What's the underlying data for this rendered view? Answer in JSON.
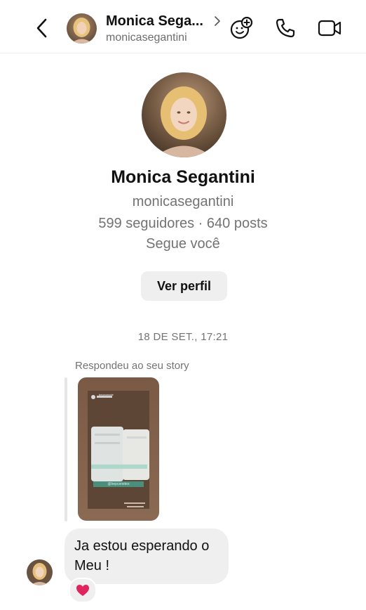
{
  "header": {
    "name": "Monica Sega...",
    "username": "monicasegantini",
    "icons": [
      "back-chevron-icon",
      "effects-face-icon",
      "phone-icon",
      "video-camera-icon"
    ]
  },
  "profile": {
    "name": "Monica Segantini",
    "username": "monicasegantini",
    "stats": "599 seguidores · 640 posts",
    "follow_status": "Segue você",
    "view_profile_label": "Ver perfil"
  },
  "thread": {
    "timestamp": "18 DE SET., 17:21",
    "story_reply_label": "Respondeu ao seu story",
    "story_preview": {
      "account_label": "bepecenete",
      "caption": "@bepcenetes"
    },
    "message": {
      "line1": "Ja estou esperando o",
      "line2": "Meu !",
      "reaction": "❤️"
    }
  },
  "colors": {
    "bubble_bg": "#efefef",
    "secondary_text": "#737373",
    "reaction_heart": "#e0245e"
  }
}
